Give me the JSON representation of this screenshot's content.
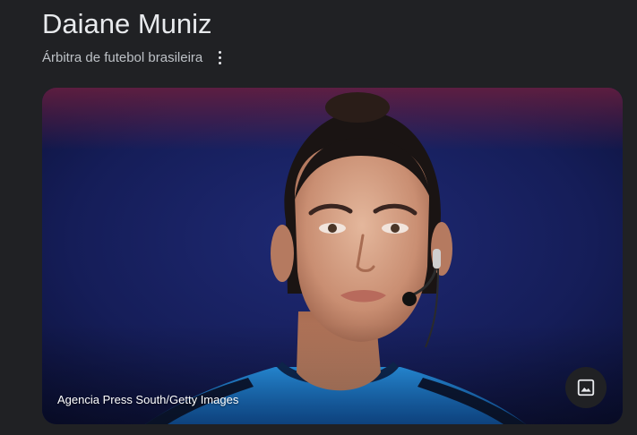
{
  "knowledge_panel": {
    "title": "Daiane Muniz",
    "subtitle": "Árbitra de futebol brasileira",
    "more_options_icon": "more-vert-icon"
  },
  "hero_image": {
    "credit": "Agencia Press South/Getty Images",
    "view_image_icon": "image-icon"
  },
  "colors": {
    "background": "#202124",
    "text_primary": "#e8eaed",
    "text_secondary": "#bdc1c6",
    "jersey_blue": "#1e88e5",
    "stadium_blue": "#16205e"
  }
}
